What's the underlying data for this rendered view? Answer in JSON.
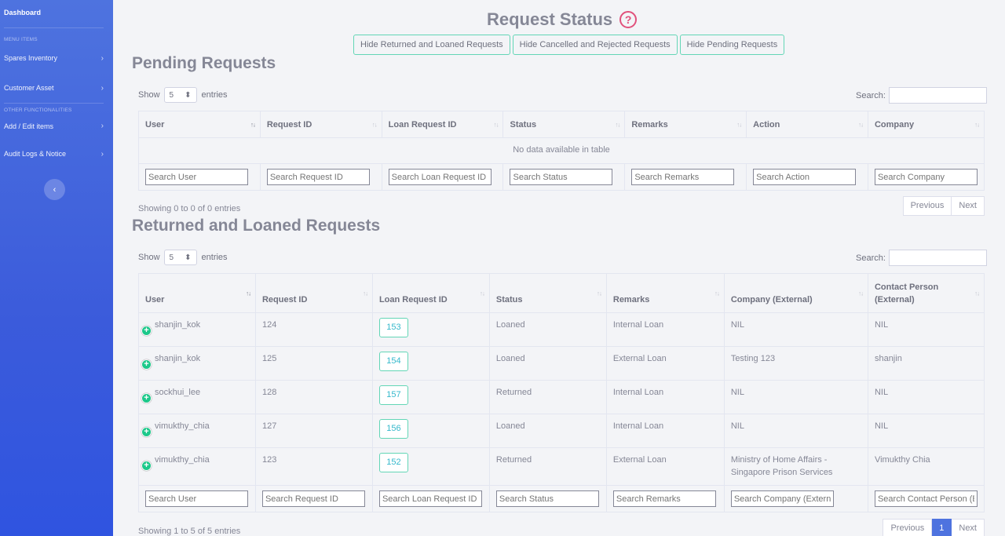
{
  "sidebar": {
    "brand": "Dashboard",
    "heading_menu": "MENU ITEMS",
    "heading_other": "OTHER FUNCTIONALITIES",
    "items": [
      {
        "label": "Spares Inventory"
      },
      {
        "label": "Customer Asset"
      },
      {
        "label": "Add / Edit items"
      },
      {
        "label": "Audit Logs & Notice"
      }
    ],
    "toggle_glyph": "‹"
  },
  "header": {
    "title": "Request Status",
    "help_glyph": "?",
    "filters": [
      "Hide Returned and Loaned Requests",
      "Hide Cancelled and Rejected Requests",
      "Hide Pending Requests"
    ]
  },
  "pending": {
    "title": "Pending Requests",
    "show_label": "Show",
    "entries_label": "entries",
    "length": "5",
    "search_label": "Search:",
    "columns": [
      "User",
      "Request ID",
      "Loan Request ID",
      "Status",
      "Remarks",
      "Action",
      "Company"
    ],
    "empty": "No data available in table",
    "column_search": [
      "Search User",
      "Search Request ID",
      "Search Loan Request ID",
      "Search Status",
      "Search Remarks",
      "Search Action",
      "Search Company"
    ],
    "info": "Showing 0 to 0 of 0 entries",
    "pager": {
      "previous": "Previous",
      "next": "Next"
    }
  },
  "returned": {
    "title": "Returned and Loaned Requests",
    "show_label": "Show",
    "entries_label": "entries",
    "length": "5",
    "search_label": "Search:",
    "columns": [
      "User",
      "Request ID",
      "Loan Request ID",
      "Status",
      "Remarks",
      "Company (External)",
      "Contact Person (External)"
    ],
    "rows": [
      {
        "user": "shanjin_kok",
        "request_id": "124",
        "loan_id": "153",
        "status": "Loaned",
        "remarks": "Internal Loan",
        "company": "NIL",
        "contact": "NIL"
      },
      {
        "user": "shanjin_kok",
        "request_id": "125",
        "loan_id": "154",
        "status": "Loaned",
        "remarks": "External Loan",
        "company": "Testing 123",
        "contact": "shanjin"
      },
      {
        "user": "sockhui_lee",
        "request_id": "128",
        "loan_id": "157",
        "status": "Returned",
        "remarks": "Internal Loan",
        "company": "NIL",
        "contact": "NIL"
      },
      {
        "user": "vimukthy_chia",
        "request_id": "127",
        "loan_id": "156",
        "status": "Loaned",
        "remarks": "Internal Loan",
        "company": "NIL",
        "contact": "NIL"
      },
      {
        "user": "vimukthy_chia",
        "request_id": "123",
        "loan_id": "152",
        "status": "Returned",
        "remarks": "External Loan",
        "company": "Ministry of Home Affairs - Singapore Prison Services",
        "contact": "Vimukthy Chia"
      }
    ],
    "column_search": [
      "Search User",
      "Search Request ID",
      "Search Loan Request ID",
      "Search Status",
      "Search Remarks",
      "Search Company (External)",
      "Search Contact Person (External)"
    ],
    "info": "Showing 1 to 5 of 5 entries",
    "pager": {
      "previous": "Previous",
      "page": "1",
      "next": "Next"
    }
  },
  "sort_glyph": "↑↓",
  "plus_glyph": "+",
  "colors": {
    "sidebar": "#4e73df",
    "accent": "#63d6b6",
    "help": "#e1517c",
    "expand": "#1cc88a"
  }
}
